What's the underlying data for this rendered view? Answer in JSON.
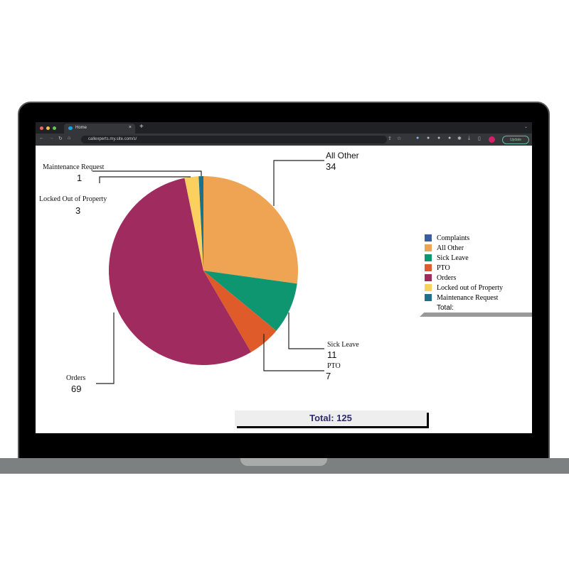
{
  "browser": {
    "tab_title": "Home",
    "url": "callexperts.my.site.com/s/",
    "update_label": "Update"
  },
  "chart_data": {
    "type": "pie",
    "title": "",
    "start": "top",
    "direction": "clockwise",
    "slices": [
      {
        "name": "All Other",
        "value": 34,
        "color": "#EFA453",
        "label": "All Other"
      },
      {
        "name": "Sick Leave",
        "value": 11,
        "color": "#0E9670",
        "label": "Sick Leave"
      },
      {
        "name": "PTO",
        "value": 7,
        "color": "#DF5B2A",
        "label": "PTO"
      },
      {
        "name": "Orders",
        "value": 69,
        "color": "#A02B5E",
        "label": "Orders"
      },
      {
        "name": "Locked out of Property",
        "value": 3,
        "color": "#FCD05E",
        "label": "Locked Out of Property"
      },
      {
        "name": "Maintenance Request",
        "value": 1,
        "color": "#1B7189",
        "label": "Maintenance Request"
      }
    ],
    "legend": {
      "placement": "right",
      "items": [
        {
          "label": "Complaints",
          "color": "#3A5F9B"
        },
        {
          "label": "All Other",
          "color": "#EFA453"
        },
        {
          "label": "Sick Leave",
          "color": "#0E9670"
        },
        {
          "label": "PTO",
          "color": "#DF5B2A"
        },
        {
          "label": "Orders",
          "color": "#A02B5E"
        },
        {
          "label": "Locked out of Property",
          "color": "#FCD05E"
        },
        {
          "label": "Maintenance Request",
          "color": "#1B7189"
        }
      ],
      "total_label": "Total:"
    },
    "total_text": "Total: 125"
  }
}
